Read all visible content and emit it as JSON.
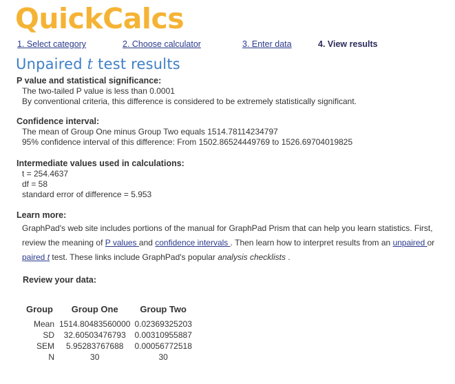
{
  "logo": {
    "text": "QuickCalcs"
  },
  "steps": {
    "step1": "1. Select category",
    "step2": "2. Choose calculator",
    "step3": "3. Enter data",
    "step4": "4. View results"
  },
  "title": {
    "prefix": "Unpaired ",
    "t": "t",
    "suffix": " test results"
  },
  "pvalue": {
    "heading": "P value and statistical significance:",
    "line1": "The two-tailed P value is less than 0.0001",
    "line2": "By conventional criteria, this difference is considered to be extremely statistically significant."
  },
  "ci": {
    "heading": "Confidence interval:",
    "line1": "The mean of Group One minus Group Two equals 1514.78114234797",
    "line2": "95% confidence interval of this difference: From 1502.86524449769 to 1526.69704019825"
  },
  "intermediate": {
    "heading": "Intermediate values used in calculations:",
    "line1": "t = 254.4637",
    "line2": "df = 58",
    "line3": "standard error of difference = 5.953"
  },
  "learn": {
    "heading": "Learn more:",
    "text1": "GraphPad's web site includes portions of the manual for GraphPad Prism that can help you learn statistics. First, review the meaning of ",
    "link_pvalues": "P values ",
    "text2": "and ",
    "link_ci": "confidence intervals ",
    "text3": ". Then learn how to interpret results from an ",
    "link_unpaired": "unpaired ",
    "text4": "or ",
    "link_paired": "paired ",
    "t": "t",
    "text5": " test. These links include GraphPad's popular ",
    "checklists": "analysis checklists",
    "text6": " ."
  },
  "review": {
    "heading": "Review your data:"
  },
  "table": {
    "headers": [
      "Group",
      "Group One",
      "Group Two"
    ],
    "rows": [
      {
        "label": "Mean",
        "one": "1514.80483560000",
        "two": "0.02369325203"
      },
      {
        "label": "SD",
        "one": "32.60503476793",
        "two": "0.00310955887"
      },
      {
        "label": "SEM",
        "one": "5.95283767688",
        "two": "0.00056772518"
      },
      {
        "label": "N",
        "one": "30",
        "two": "30"
      }
    ]
  },
  "colors": {
    "logo": "#f5b335",
    "title": "#3f7fc6",
    "link": "#2b3a8c"
  }
}
